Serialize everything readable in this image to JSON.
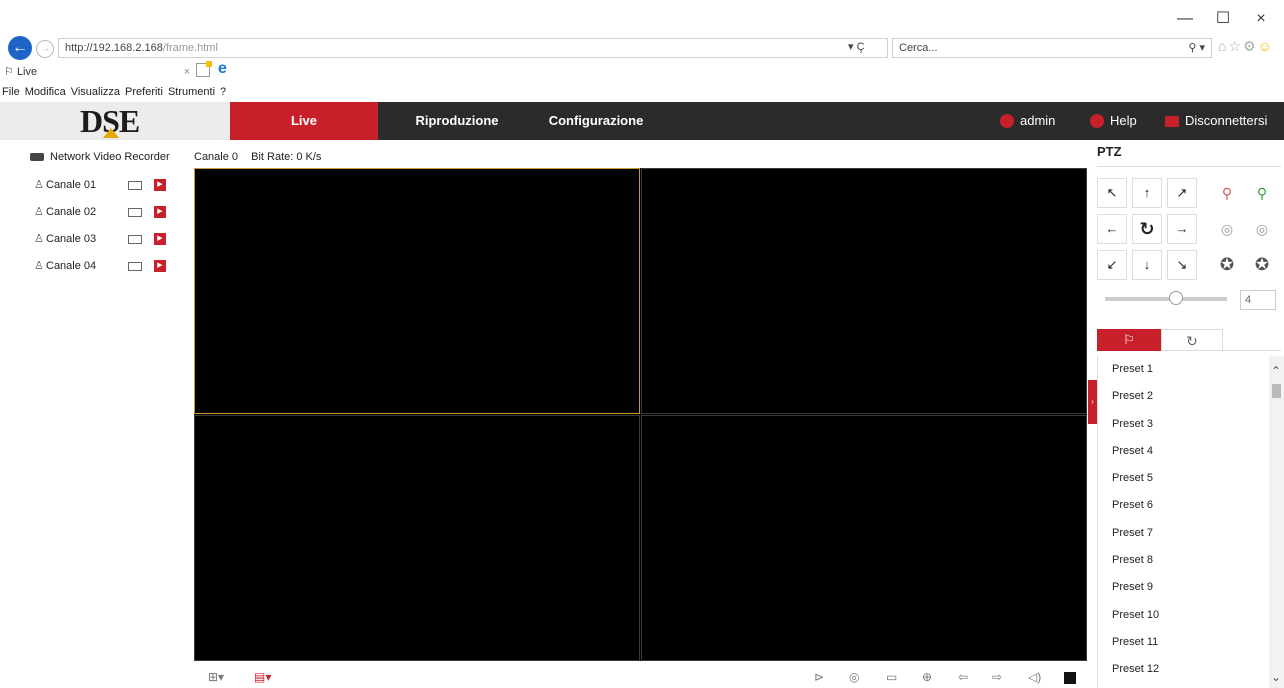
{
  "browser": {
    "url_prefix": "http://192.168.2.168",
    "url_path": "/frame.html",
    "url_dropdown": "▾ Ç",
    "search_placeholder": "Cerca...",
    "search_go": "⚲ ▾",
    "tab_title": "Live",
    "tab_close": "×",
    "window_controls": {
      "minimize": "—",
      "maximize": "☐",
      "close": "×"
    },
    "menu": [
      "File",
      "Modifica",
      "Visualizza",
      "Preferiti",
      "Strumenti",
      "?"
    ]
  },
  "nav": {
    "logo": "DSE",
    "tabs": [
      "Live",
      "Riproduzione",
      "Configurazione"
    ],
    "user": "admin",
    "help": "Help",
    "logout": "Disconnettersi"
  },
  "device": {
    "name": "Network Video Recorder",
    "channels": [
      "Canale 01",
      "Canale 02",
      "Canale 03",
      "Canale 04"
    ]
  },
  "info": {
    "channel": "Canale 0",
    "bitrate": "Bit Rate: 0 K/s"
  },
  "ptz": {
    "title": "PTZ",
    "directions": [
      "↖",
      "↑",
      "↗",
      "←",
      "↻",
      "→",
      "↙",
      "↓",
      "↘"
    ],
    "speed": "4",
    "presets": [
      "Preset 1",
      "Preset 2",
      "Preset 3",
      "Preset 4",
      "Preset 5",
      "Preset 6",
      "Preset 7",
      "Preset 8",
      "Preset 9",
      "Preset 10",
      "Preset 11",
      "Preset 12"
    ]
  },
  "colors": {
    "accent": "#c8202a",
    "nav_bg": "#2b2b2b",
    "selected_cell_border": "#c89a2e"
  }
}
